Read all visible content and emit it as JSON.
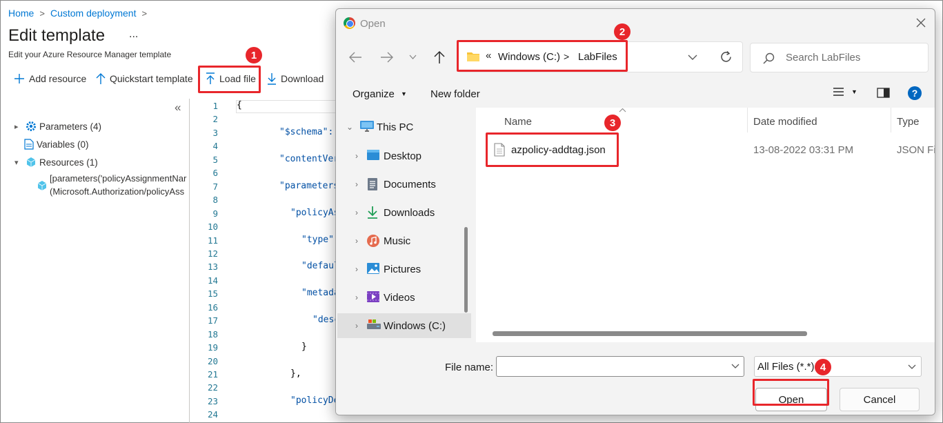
{
  "portal": {
    "breadcrumb": [
      "Home",
      "Custom deployment"
    ],
    "title": "Edit template",
    "more": "...",
    "subtitle": "Edit your Azure Resource Manager template",
    "toolbar": {
      "add_resource": "Add resource",
      "quickstart": "Quickstart template",
      "load_file": "Load file",
      "download": "Download"
    },
    "collapse": "«",
    "tree": {
      "parameters": "Parameters (4)",
      "variables": "Variables (0)",
      "resources": "Resources (1)",
      "resource_line1": "[parameters('policyAssignmentNar",
      "resource_line2": "(Microsoft.Authorization/policyAss"
    },
    "editor": {
      "line_numbers": [
        "1",
        "2",
        "3",
        "4",
        "5",
        "6",
        "7",
        "8",
        "9",
        "10",
        "11",
        "12",
        "13",
        "14",
        "15",
        "16",
        "17",
        "18",
        "19",
        "20",
        "21",
        "22",
        "23",
        "24"
      ],
      "code": {
        "l1": "{",
        "l3": "\"$schema\":",
        "l5": "\"contentVer",
        "l7": "\"parameters",
        "l9": "\"policyAs",
        "l11": "\"type\":",
        "l13": "\"defaul",
        "l15": "\"metada",
        "l17": "\"desc",
        "l19": "}",
        "l21": "},",
        "l23": "\"policyDe"
      }
    }
  },
  "dialog": {
    "title": "Open",
    "address": {
      "chevrons": "«",
      "parts": [
        "Windows (C:)",
        "LabFiles"
      ],
      "separator": ">"
    },
    "search_placeholder": "Search LabFiles",
    "toolbar": {
      "organize": "Organize",
      "new_folder": "New folder"
    },
    "nav": {
      "items": [
        {
          "label": "This PC",
          "icon": "pc-icon"
        },
        {
          "label": "Desktop",
          "icon": "desktop-icon"
        },
        {
          "label": "Documents",
          "icon": "documents-icon"
        },
        {
          "label": "Downloads",
          "icon": "downloads-icon"
        },
        {
          "label": "Music",
          "icon": "music-icon"
        },
        {
          "label": "Pictures",
          "icon": "pictures-icon"
        },
        {
          "label": "Videos",
          "icon": "videos-icon"
        },
        {
          "label": "Windows (C:)",
          "icon": "drive-icon"
        }
      ],
      "selected": "Windows (C:)"
    },
    "columns": {
      "name": "Name",
      "date": "Date modified",
      "type": "Type"
    },
    "files": [
      {
        "name": "azpolicy-addtag.json",
        "date": "13-08-2022 03:31 PM",
        "type": "JSON File"
      }
    ],
    "file_name_label": "File name:",
    "file_name_value": "",
    "file_type": "All Files (*.*)",
    "open_label": "Open",
    "cancel_label": "Cancel"
  },
  "callouts": [
    "1",
    "2",
    "3",
    "4"
  ],
  "colors": {
    "accent": "#0078d4",
    "callout": "#e8262b"
  }
}
